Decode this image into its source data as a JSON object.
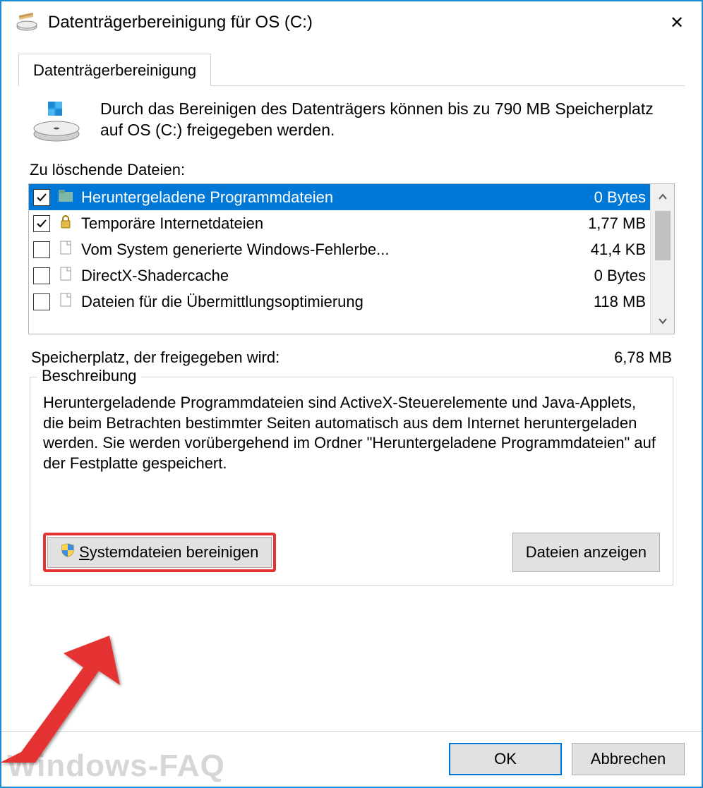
{
  "title": "Datenträgerbereinigung für OS (C:)",
  "tab_label": "Datenträgerbereinigung",
  "intro_text": "Durch das Bereinigen des Datenträgers können bis zu 790 MB Speicherplatz auf OS (C:) freigegeben werden.",
  "files_to_delete_label": "Zu löschende Dateien:",
  "items": [
    {
      "label": "Heruntergeladene Programmdateien",
      "size": "0 Bytes",
      "checked": true,
      "selected": true,
      "icon": "folder"
    },
    {
      "label": "Temporäre Internetdateien",
      "size": "1,77 MB",
      "checked": true,
      "selected": false,
      "icon": "lock"
    },
    {
      "label": "Vom System generierte Windows-Fehlerbe...",
      "size": "41,4 KB",
      "checked": false,
      "selected": false,
      "icon": "file"
    },
    {
      "label": "DirectX-Shadercache",
      "size": "0 Bytes",
      "checked": false,
      "selected": false,
      "icon": "file"
    },
    {
      "label": "Dateien für die Übermittlungsoptimierung",
      "size": "118 MB",
      "checked": false,
      "selected": false,
      "icon": "file"
    }
  ],
  "free_space_label": "Speicherplatz, der freigegeben wird:",
  "free_space_value": "6,78 MB",
  "description_title": "Beschreibung",
  "description_text": "Heruntergeladende Programmdateien sind ActiveX-Steuerelemente und Java-Applets, die beim Betrachten bestimmter Seiten automatisch aus dem Internet heruntergeladen werden. Sie werden vorübergehend im Ordner \"Heruntergeladene Programmdateien\" auf der Festplatte gespeichert.",
  "btn_clean_system": "Systemdateien bereinigen",
  "btn_view_files": "Dateien anzeigen",
  "btn_ok": "OK",
  "btn_cancel": "Abbrechen",
  "watermark": "Windows-FAQ"
}
